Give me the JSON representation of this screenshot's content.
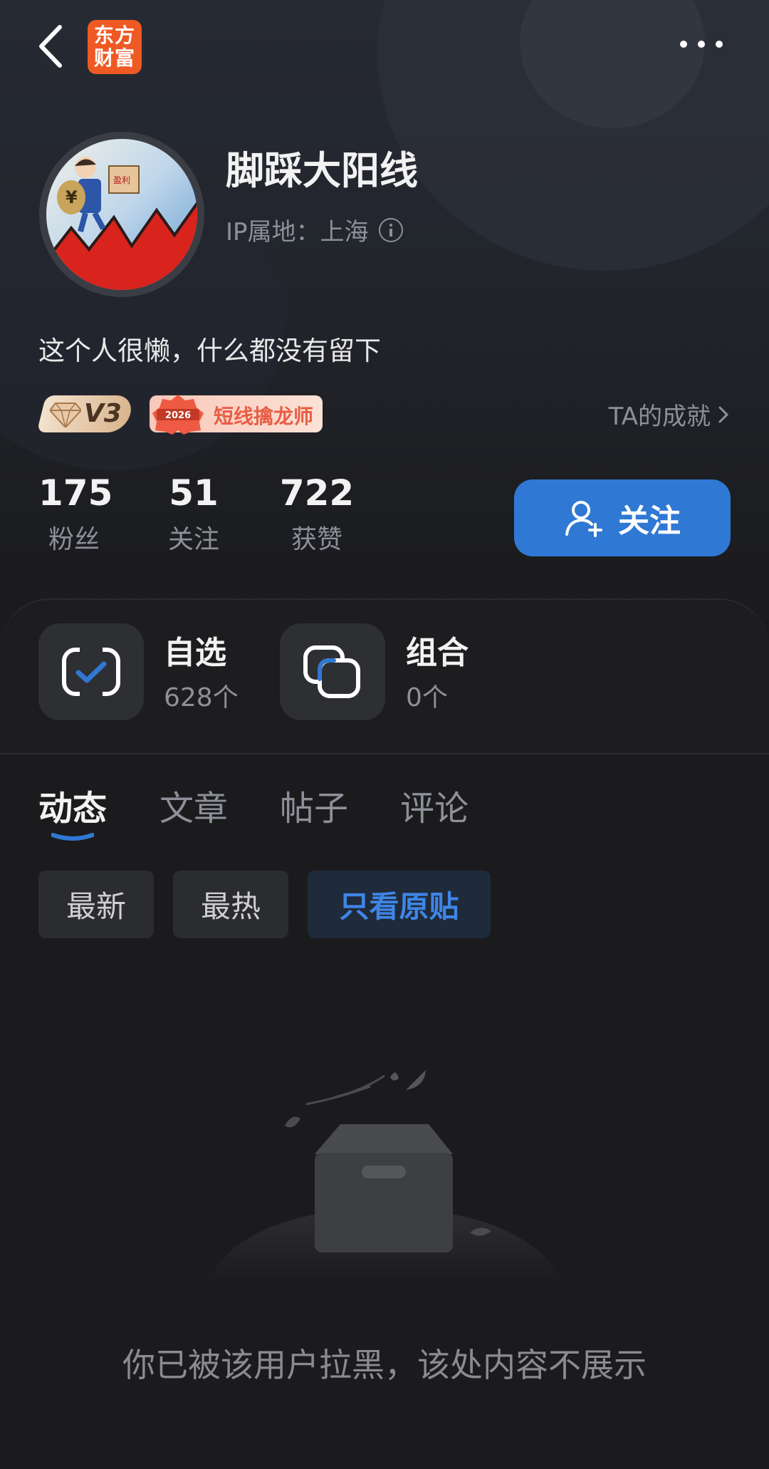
{
  "topbar": {
    "logo_line1": "东方",
    "logo_line2": "财富"
  },
  "profile": {
    "username": "脚踩大阳线",
    "ip_location": "IP属地：上海",
    "bio": "这个人很懒，什么都没有留下",
    "level_badge": "V3",
    "honor_badge_year": "2026",
    "honor_badge": "短线擒龙师",
    "achievement_link": "TA的成就"
  },
  "stats": [
    {
      "value": "175",
      "label": "粉丝"
    },
    {
      "value": "51",
      "label": "关注"
    },
    {
      "value": "722",
      "label": "获赞"
    }
  ],
  "follow_button": "关注",
  "tools": [
    {
      "title": "自选",
      "count": "628个"
    },
    {
      "title": "组合",
      "count": "0个"
    }
  ],
  "tabs": [
    "动态",
    "文章",
    "帖子",
    "评论"
  ],
  "filters": [
    "最新",
    "最热",
    "只看原贴"
  ],
  "empty_message": "你已被该用户拉黑，该处内容不展示",
  "colors": {
    "accent": "#2f78d4",
    "logo": "#ef5a24",
    "background": "#1b1b1d"
  }
}
